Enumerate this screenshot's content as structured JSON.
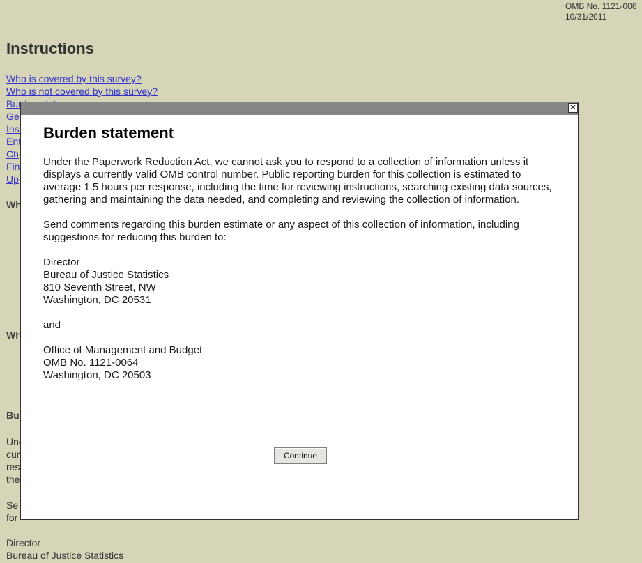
{
  "omb": {
    "number": "OMB No. 1121-006",
    "date": "10/31/2011"
  },
  "page": {
    "title": "Instructions",
    "toc_links": [
      "Who is covered by this survey?",
      "Who is not covered by this survey?",
      "Burden statement",
      "Ge",
      "Inst",
      "Ent",
      "Ch",
      "Fin",
      "Up"
    ],
    "bg_headings": [
      "Wh",
      "Wh",
      "Bu"
    ],
    "bg_lines": [
      "Und",
      "cur",
      "res",
      "the",
      "Se",
      "for",
      "Director",
      "Bureau of Justice Statistics"
    ]
  },
  "modal": {
    "close_symbol": "✕",
    "title": "Burden statement",
    "paragraph1": "Under the Paperwork Reduction Act, we cannot ask you to respond to a collection of information unless it displays a currently valid OMB control number. Public reporting burden for this collection is estimated to average 1.5 hours per response, including the time for reviewing instructions, searching existing data sources, gathering and maintaining the data needed, and completing and reviewing the collection of information.",
    "paragraph2": "Send comments regarding this burden estimate or any aspect of this collection of information, including suggestions for reducing this burden to:",
    "address1": [
      "Director",
      "Bureau of Justice Statistics",
      "810 Seventh Street, NW",
      "Washington, DC 20531"
    ],
    "conjunction": "and",
    "address2": [
      "Office of Management and Budget",
      "OMB No. 1121-0064",
      "Washington, DC 20503"
    ],
    "continue_label": "Continue"
  }
}
